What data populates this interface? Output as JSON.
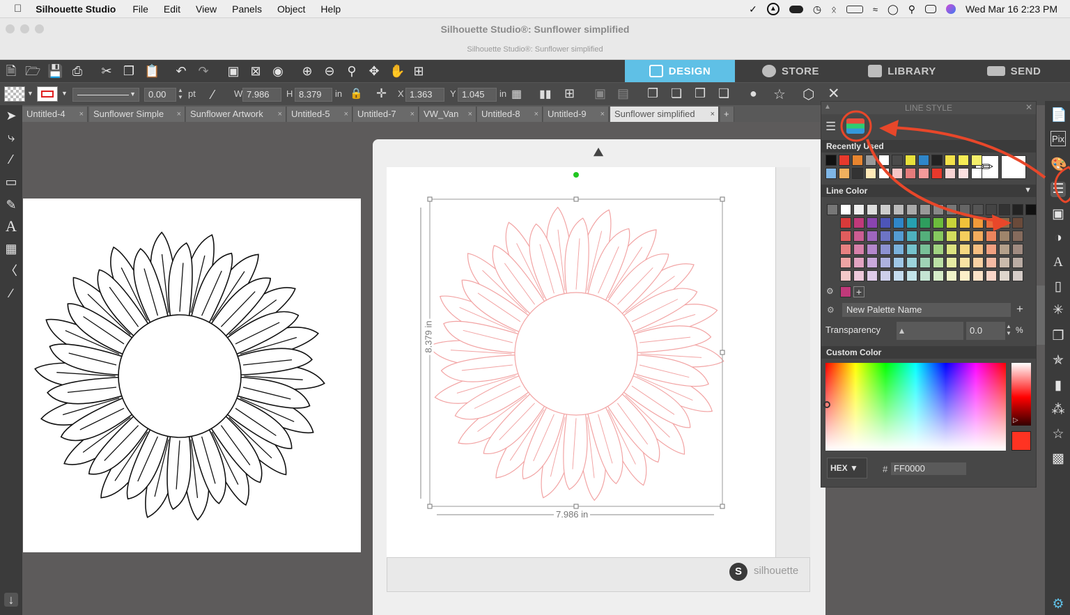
{
  "menubar": {
    "app": "Silhouette Studio",
    "items": [
      "File",
      "Edit",
      "View",
      "Panels",
      "Object",
      "Help"
    ],
    "datetime": "Wed Mar 16  2:23 PM"
  },
  "window": {
    "title": "Silhouette Studio®: Sunflower simplified",
    "subtitle": "Silhouette Studio®: Sunflower simplified"
  },
  "nav": {
    "design": "DESIGN",
    "store": "STORE",
    "library": "LIBRARY",
    "send": "SEND"
  },
  "toolbar": {
    "line_width": "0.00",
    "line_unit": "pt",
    "w_label": "W",
    "w_value": "7.986",
    "h_label": "H",
    "h_value": "8.379",
    "size_unit": "in",
    "x_label": "X",
    "x_value": "1.363",
    "y_label": "Y",
    "y_value": "1.045",
    "pos_unit": "in"
  },
  "tabs": [
    "Untitled-4",
    "Sunflower Simple",
    "Sunflower Artwork",
    "Untitled-5",
    "Untitled-7",
    "VW_Van",
    "Untitled-8",
    "Untitled-9",
    "Sunflower simplified"
  ],
  "tab_close": "×",
  "tab_add": "+",
  "canvas": {
    "height_dim": "8.379 in",
    "width_dim": "7.986 in",
    "brand": "silhouette"
  },
  "panel": {
    "title": "LINE STYLE",
    "recently_used": "Recently Used",
    "line_color": "Line Color",
    "palette_name": "New Palette Name",
    "transparency_label": "Transparency",
    "transparency_value": "0.0",
    "percent": "%",
    "custom_color": "Custom Color",
    "hex_mode": "HEX",
    "hash": "#",
    "hex_value": "FF0000"
  },
  "colors": {
    "accent": "#5fc0e6",
    "selected": "#ff0000",
    "annotation": "#e8472a",
    "design_tab": "#5fc0e6",
    "outline_pink": "#f2a3a3"
  }
}
